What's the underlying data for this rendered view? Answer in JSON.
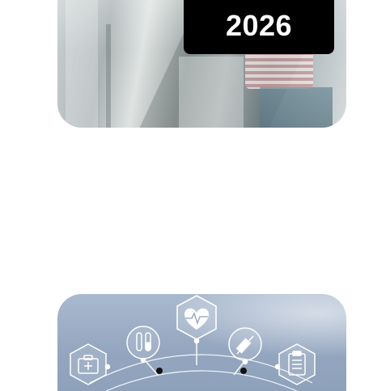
{
  "top_card": {
    "year": "2026"
  },
  "bottom_card": {
    "icons": [
      "medical-kit-icon",
      "test-tubes-icon",
      "heart-pulse-icon",
      "syringe-icon",
      "clipboard-icon"
    ]
  }
}
